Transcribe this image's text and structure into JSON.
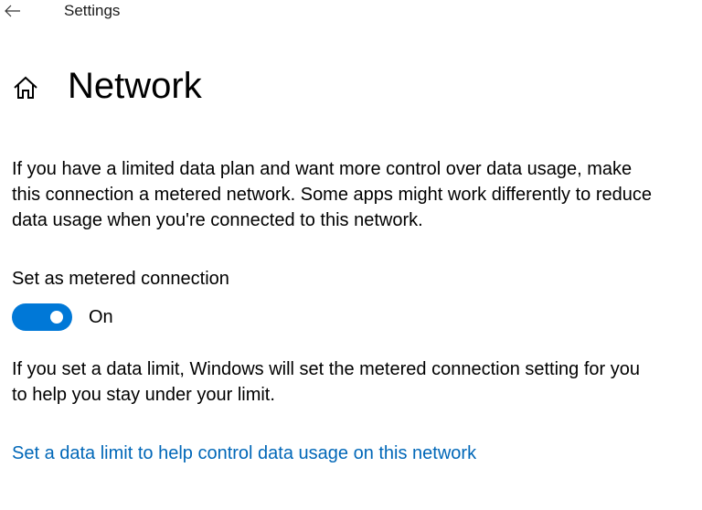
{
  "window": {
    "title": "Settings"
  },
  "page": {
    "title": "Network",
    "description": "If you have a limited data plan and want more control over data usage, make this connection a metered network. Some apps might work differently to reduce data usage when you're connected to this network."
  },
  "metered": {
    "label": "Set as metered connection",
    "state_text": "On",
    "enabled": true
  },
  "data_limit": {
    "description": "If you set a data limit, Windows will set the metered connection setting for you to help you stay under your limit.",
    "link_text": "Set a data limit to help control data usage on this network"
  },
  "icons": {
    "back": "back-arrow-icon",
    "home": "home-icon"
  },
  "colors": {
    "accent": "#0078d7",
    "link": "#0067b8"
  }
}
